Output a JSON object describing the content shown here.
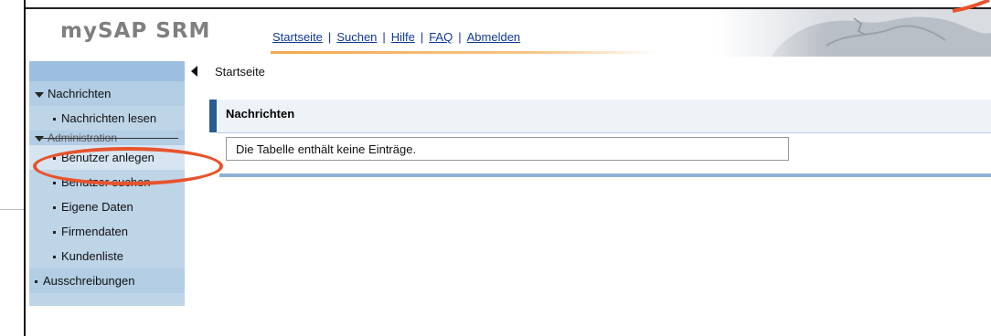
{
  "header": {
    "logo": "mySAP SRM",
    "nav": [
      {
        "label": "Startseite"
      },
      {
        "label": "Suchen"
      },
      {
        "label": "Hilfe"
      },
      {
        "label": "FAQ"
      },
      {
        "label": "Abmelden"
      }
    ],
    "separator": "|"
  },
  "sidebar": {
    "items": [
      {
        "label": "Nachrichten",
        "type": "group",
        "expanded": true
      },
      {
        "label": "Nachrichten lesen",
        "type": "sub"
      },
      {
        "label": "Administration",
        "type": "group",
        "expanded": true,
        "partially_obscured": true
      },
      {
        "label": "Benutzer anlegen",
        "type": "sub",
        "highlighted": true
      },
      {
        "label": "Benutzer suchen",
        "type": "sub"
      },
      {
        "label": "Eigene Daten",
        "type": "sub"
      },
      {
        "label": "Firmendaten",
        "type": "sub"
      },
      {
        "label": "Kundenliste",
        "type": "sub"
      },
      {
        "label": "Ausschreibungen",
        "type": "group",
        "expanded": false
      }
    ]
  },
  "breadcrumb": "Startseite",
  "panel": {
    "title": "Nachrichten",
    "empty_message": "Die Tabelle enthält keine Einträge."
  },
  "colors": {
    "sidebar_bg": "#bed4e7",
    "nav_link": "#123a96",
    "panel_accent": "#2b5c97",
    "annotation": "#e8532c"
  }
}
